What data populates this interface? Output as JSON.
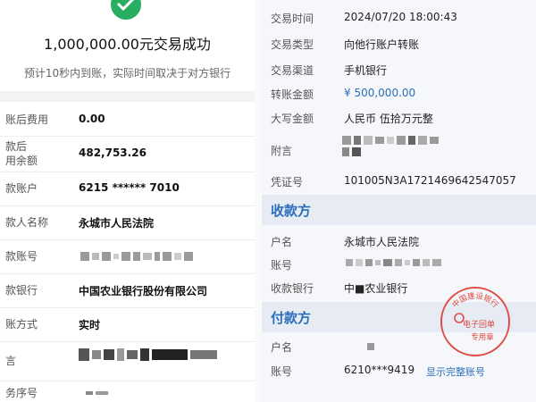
{
  "left": {
    "title": "1,000,000.00元交易成功",
    "notice": "预计10秒内到账，实际时间取决于对方银行",
    "rows": [
      {
        "label": "账后费用",
        "value": "0.00"
      },
      {
        "label": "款后\n用余额",
        "value": "482,753.26"
      },
      {
        "label": "款账户",
        "value": "6215 ****** 7010"
      },
      {
        "label": "款人名称",
        "value": "永城市人民法院"
      },
      {
        "label": "款账号",
        "value": ""
      },
      {
        "label": "款银行",
        "value": "中国农业银行股份有限公司"
      },
      {
        "label": "账方式",
        "value": "实时"
      },
      {
        "label": "言",
        "value": ""
      },
      {
        "label": "务序号",
        "value": ""
      }
    ]
  },
  "right": {
    "details": [
      {
        "label": "交易时间",
        "value": "2024/07/20 18:00:43"
      },
      {
        "label": "交易类型",
        "value": "向他行账户转账"
      },
      {
        "label": "交易渠道",
        "value": "手机银行"
      },
      {
        "label": "转账金额",
        "value": "¥ 500,000.00",
        "blue": true
      },
      {
        "label": "大写金额",
        "value": "人民币 伍拾万元整"
      },
      {
        "label": "附言",
        "value": ""
      },
      {
        "label": "凭证号",
        "value": "101005N3A1721469642547057"
      }
    ],
    "payee": {
      "title": "收款方",
      "name_label": "户名",
      "name_value": "永城市人民法院",
      "account_label": "账号",
      "bank_label": "收款银行",
      "bank_value": "中■农业银行"
    },
    "payer": {
      "title": "付款方",
      "name_label": "户名",
      "account_label": "账号",
      "account_value": "6210***9419",
      "show_full_link": "显示完整账号"
    },
    "stamp": {
      "top_text": "中国建设银行",
      "middle_text": "电子回单",
      "bottom_text": "专用章"
    }
  },
  "colors": {
    "accent": "#2a6fb8",
    "success": "#27ae60",
    "stamp": "#d9342b"
  }
}
